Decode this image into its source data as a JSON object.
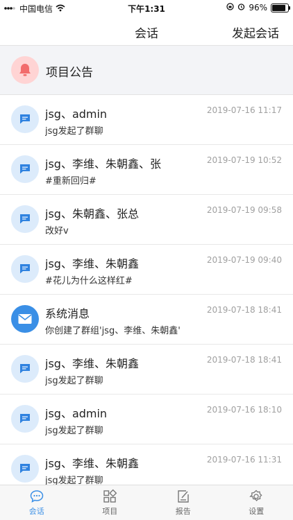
{
  "status_bar": {
    "carrier": "中国电信",
    "time": "下午1:31",
    "battery_percent": "96%",
    "battery_level": 0.96
  },
  "nav": {
    "title": "会话",
    "action": "发起会话"
  },
  "announcement": {
    "label": "项目公告",
    "icon": "bell-icon",
    "color": "#f26c6c"
  },
  "conversations": [
    {
      "title": "jsg、admin",
      "time": "2019-07-16 11:17",
      "preview": "jsg发起了群聊",
      "icon": "chat-icon"
    },
    {
      "title": "jsg、李维、朱朝鑫、张",
      "time": "2019-07-19 10:52",
      "preview": "#重新回归#",
      "icon": "chat-icon"
    },
    {
      "title": "jsg、朱朝鑫、张总",
      "time": "2019-07-19 09:58",
      "preview": "改好v",
      "icon": "chat-icon"
    },
    {
      "title": "jsg、李维、朱朝鑫",
      "time": "2019-07-19 09:40",
      "preview": "#花儿为什么这样红#",
      "icon": "chat-icon"
    },
    {
      "title": "系统消息",
      "time": "2019-07-18 18:41",
      "preview": "你创建了群组'jsg、李维、朱朝鑫'",
      "icon": "mail-icon"
    },
    {
      "title": "jsg、李维、朱朝鑫",
      "time": "2019-07-18 18:41",
      "preview": "jsg发起了群聊",
      "icon": "chat-icon"
    },
    {
      "title": "jsg、admin",
      "time": "2019-07-16 18:10",
      "preview": "jsg发起了群聊",
      "icon": "chat-icon"
    },
    {
      "title": "jsg、李维、朱朝鑫",
      "time": "2019-07-16 11:31",
      "preview": "jsg发起了群聊",
      "icon": "chat-icon"
    }
  ],
  "tabs": [
    {
      "label": "会话",
      "icon": "chat-bubble-icon",
      "active": true
    },
    {
      "label": "项目",
      "icon": "grid-icon",
      "active": false
    },
    {
      "label": "报告",
      "icon": "report-icon",
      "active": false
    },
    {
      "label": "设置",
      "icon": "gear-icon",
      "active": false
    }
  ],
  "colors": {
    "accent": "#3a8fe6",
    "avatar_bg": "#dcebfb",
    "announcement_bg": "#f3f4f7"
  }
}
